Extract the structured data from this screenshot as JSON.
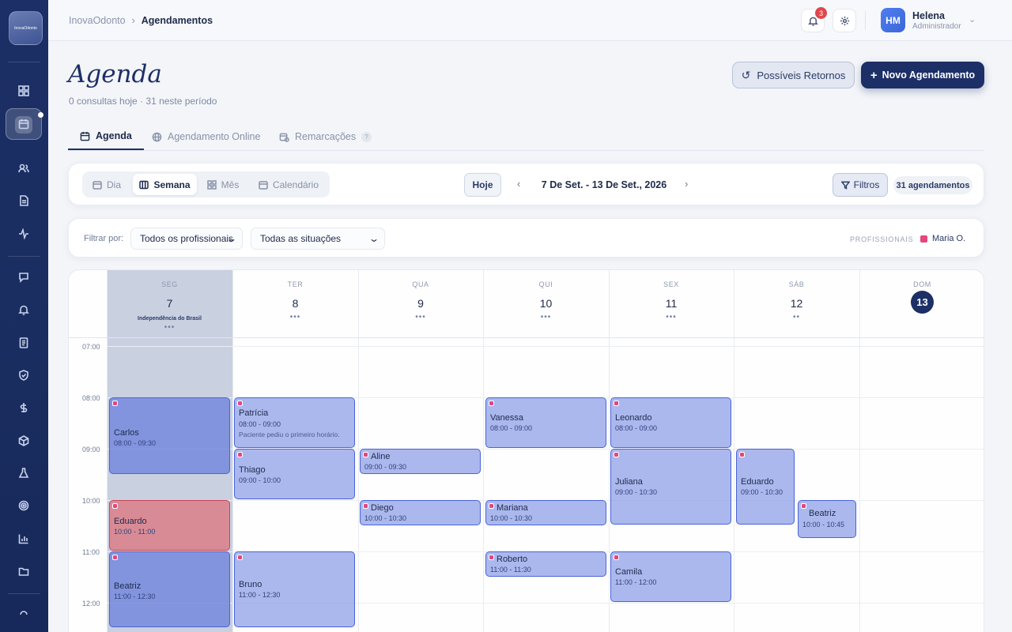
{
  "sidebar": {
    "logo_text": "InovaOdonto",
    "items": [
      "grid-icon",
      "calendar-icon",
      "users-icon",
      "document-icon",
      "activity-icon",
      "message-icon",
      "alarm-icon",
      "receipt-icon",
      "shield-icon",
      "dollar-icon",
      "box-icon",
      "flask-icon",
      "target-icon",
      "bar-chart-icon",
      "folder-icon",
      "more-icon"
    ]
  },
  "header": {
    "breadcrumb_root": "InovaOdonto",
    "breadcrumb_sep": "›",
    "breadcrumb_current": "Agendamentos",
    "notifications_count": "3",
    "user_initials": "HM",
    "user_name": "Helena",
    "user_role": "Administrador"
  },
  "page": {
    "title": "Agenda",
    "subtitle": "0 consultas hoje · 31 neste período",
    "btn_returns": "Possíveis Retornos",
    "btn_new": "Novo Agendamento"
  },
  "tabs": [
    {
      "label": "Agenda",
      "active": true
    },
    {
      "label": "Agendamento Online",
      "active": false
    },
    {
      "label": "Remarcações",
      "active": false
    }
  ],
  "toolbar": {
    "views": [
      "Dia",
      "Semana",
      "Mês",
      "Calendário"
    ],
    "active_view": "Semana",
    "today": "Hoje",
    "prev": "‹",
    "next": "›",
    "range": "7 De Set. - 13 De Set., 2026",
    "filters": "Filtros",
    "count": "31 agendamentos"
  },
  "filters": {
    "label": "Filtrar por:",
    "professional": "Todos os profissionais",
    "status": "Todas as situações",
    "professionals_label": "PROFISSIONAIS",
    "professional_chip": "Maria O.",
    "professional_color": "#e4467f"
  },
  "calendar": {
    "days": [
      {
        "name": "SEG",
        "num": "7",
        "holiday": "Independência do Brasil",
        "dots": "•••"
      },
      {
        "name": "TER",
        "num": "8",
        "dots": "•••"
      },
      {
        "name": "QUA",
        "num": "9",
        "dots": "•••"
      },
      {
        "name": "QUI",
        "num": "10",
        "dots": "•••"
      },
      {
        "name": "SEX",
        "num": "11",
        "dots": "•••"
      },
      {
        "name": "SÁB",
        "num": "12",
        "dots": "••"
      },
      {
        "name": "DOM",
        "num": "13",
        "dots": ""
      }
    ],
    "hours": [
      "07:00",
      "08:00",
      "09:00",
      "10:00",
      "11:00",
      "12:00"
    ],
    "events": [
      {
        "name": "Carlos",
        "time": "08:00 - 09:30"
      },
      {
        "name": "Eduardo",
        "time": "10:00 - 11:00"
      },
      {
        "name": "Beatriz",
        "time": "11:00 - 12:30"
      },
      {
        "name": "Patrícia",
        "time": "08:00 - 09:00",
        "note": "Paciente pediu o primeiro horário."
      },
      {
        "name": "Thiago",
        "time": "09:00 - 10:00"
      },
      {
        "name": "Bruno",
        "time": "11:00 - 12:30"
      },
      {
        "name": "Aline",
        "time": "09:00 - 09:30"
      },
      {
        "name": "Diego",
        "time": "10:00 - 10:30"
      },
      {
        "name": "Vanessa",
        "time": "08:00 - 09:00"
      },
      {
        "name": "Mariana",
        "time": "10:00 - 10:30"
      },
      {
        "name": "Roberto",
        "time": "11:00 - 11:30"
      },
      {
        "name": "Leonardo",
        "time": "08:00 - 09:00"
      },
      {
        "name": "Juliana",
        "time": "09:00 - 10:30"
      },
      {
        "name": "Camila",
        "time": "11:00 - 12:00"
      },
      {
        "name": "Eduardo",
        "time": "09:00 - 10:30"
      },
      {
        "name": "Beatriz",
        "time": "10:00 - 10:45"
      }
    ]
  }
}
